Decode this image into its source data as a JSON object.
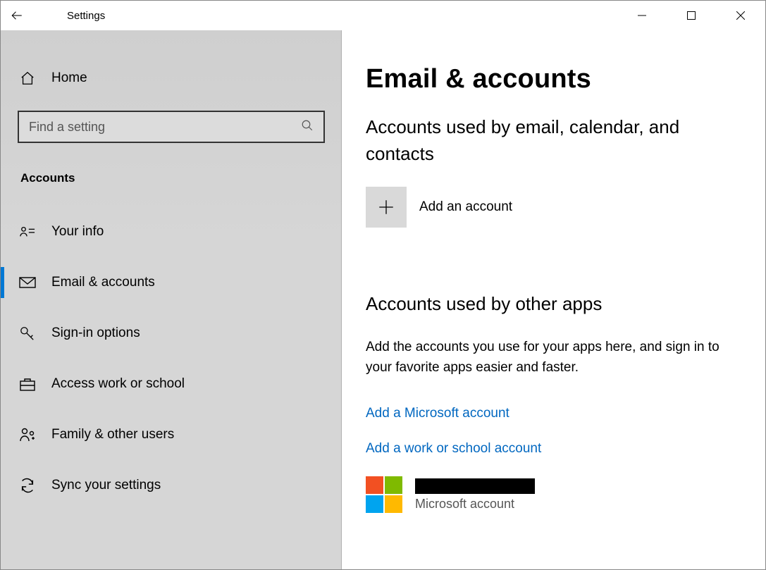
{
  "window": {
    "title": "Settings"
  },
  "sidebar": {
    "home_label": "Home",
    "search_placeholder": "Find a setting",
    "category": "Accounts",
    "items": [
      {
        "label": "Your info",
        "icon": "user-info-icon"
      },
      {
        "label": "Email & accounts",
        "icon": "mail-icon"
      },
      {
        "label": "Sign-in options",
        "icon": "key-icon"
      },
      {
        "label": "Access work or school",
        "icon": "briefcase-icon"
      },
      {
        "label": "Family & other users",
        "icon": "family-icon"
      },
      {
        "label": "Sync your settings",
        "icon": "sync-icon"
      }
    ]
  },
  "main": {
    "title": "Email & accounts",
    "section1_title": "Accounts used by email, calendar, and contacts",
    "add_account_label": "Add an account",
    "section2_title": "Accounts used by other apps",
    "section2_desc": "Add the accounts you use for your apps here, and sign in to your favorite apps easier and faster.",
    "link1_label": "Add a Microsoft account",
    "link2_label": "Add a work or school account",
    "account_type": "Microsoft account"
  }
}
